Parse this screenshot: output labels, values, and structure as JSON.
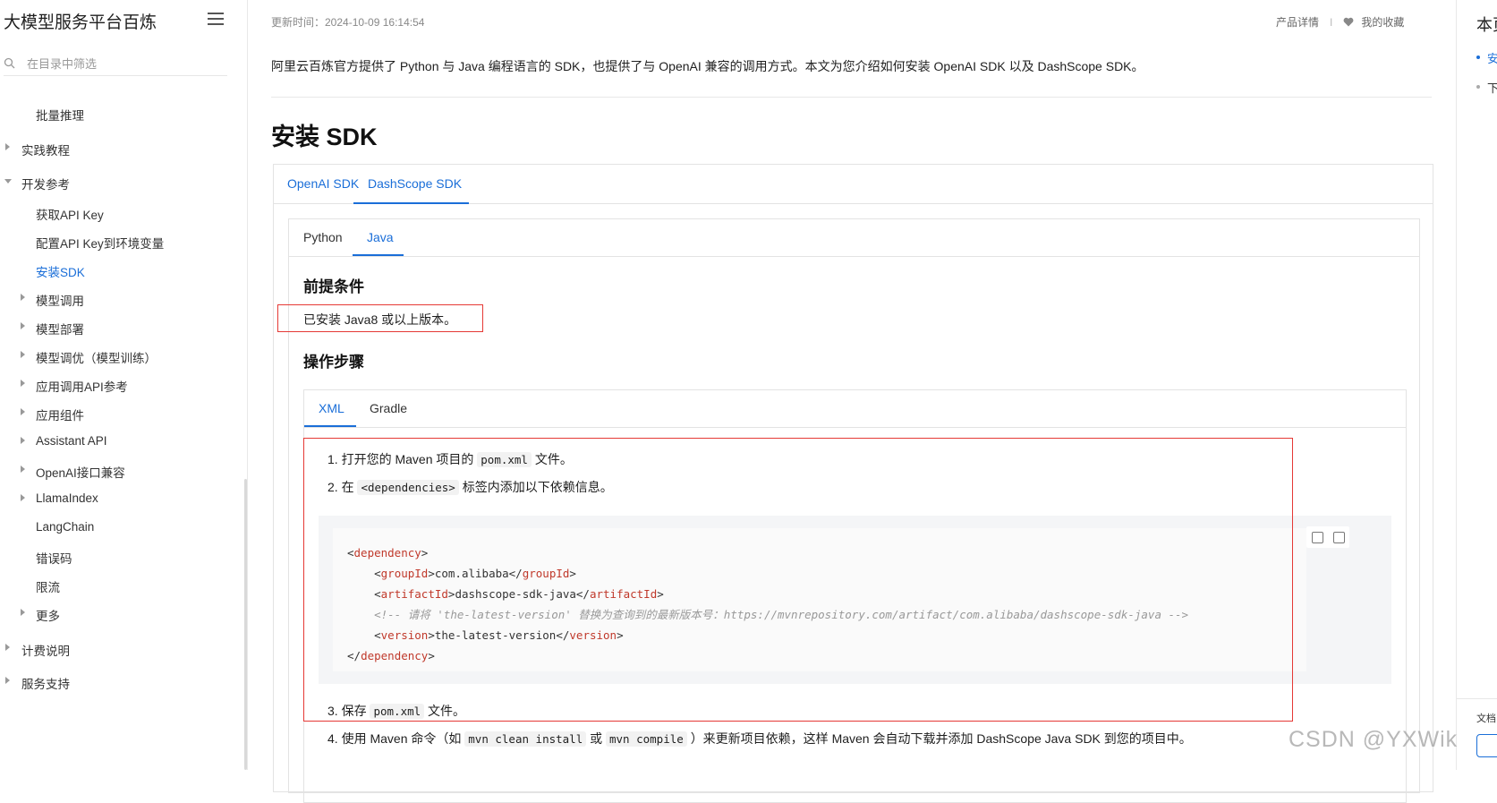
{
  "sidebar": {
    "title": "大模型服务平台百炼",
    "search_placeholder": "在目录中筛选",
    "items": [
      {
        "label": "批量推理"
      },
      {
        "label": "实践教程"
      },
      {
        "label": "开发参考"
      },
      {
        "label": "获取API Key"
      },
      {
        "label": "配置API Key到环境变量"
      },
      {
        "label": "安装SDK"
      },
      {
        "label": "模型调用"
      },
      {
        "label": "模型部署"
      },
      {
        "label": "模型调优（模型训练）"
      },
      {
        "label": "应用调用API参考"
      },
      {
        "label": "应用组件"
      },
      {
        "label": "Assistant API"
      },
      {
        "label": "OpenAI接口兼容"
      },
      {
        "label": "LlamaIndex"
      },
      {
        "label": "LangChain"
      },
      {
        "label": "错误码"
      },
      {
        "label": "限流"
      },
      {
        "label": "更多"
      },
      {
        "label": "计费说明"
      },
      {
        "label": "服务支持"
      }
    ]
  },
  "header": {
    "updated": "更新时间：2024-10-09 16:14:54",
    "product_details": "产品详情",
    "separator": "I",
    "favorites": "我的收藏"
  },
  "main": {
    "intro": "阿里云百炼官方提供了 Python 与 Java 编程语言的 SDK，也提供了与 OpenAI 兼容的调用方式。本文为您介绍如何安装 OpenAI SDK 以及 DashScope SDK。",
    "title": "安装 SDK",
    "sdk_tabs": [
      {
        "label": "OpenAI SDK"
      },
      {
        "label": "DashScope SDK"
      }
    ],
    "lang_tabs": [
      {
        "label": "Python"
      },
      {
        "label": "Java"
      }
    ],
    "prereq_heading": "前提条件",
    "prereq_text": "已安装 Java8 或以上版本。",
    "steps_heading": "操作步骤",
    "build_tabs": [
      {
        "label": "XML"
      },
      {
        "label": "Gradle"
      }
    ],
    "steps": {
      "s1": {
        "num": "1.",
        "pre": "打开您的 Maven 项目的",
        "code": "pom.xml",
        "post": "文件。"
      },
      "s2": {
        "num": "2.",
        "pre": "在",
        "code": "<dependencies>",
        "post": "标签内添加以下依赖信息。"
      },
      "s3": {
        "num": "3.",
        "pre": "保存",
        "code": "pom.xml",
        "post": "文件。"
      },
      "s4": {
        "num": "4.",
        "pre": "使用 Maven 命令（如",
        "code1": "mvn clean install",
        "mid": "或",
        "code2": "mvn compile",
        "post": "）来更新项目依赖，这样 Maven 会自动下载并添加 DashScope Java SDK 到您的项目中。"
      }
    },
    "code": {
      "dependency_tag": "dependency",
      "groupId_tag": "groupId",
      "groupId": "com.alibaba",
      "artifactId_tag": "artifactId",
      "artifactId": "dashscope-sdk-java",
      "comment": "<!-- 请将 'the-latest-version' 替换为查询到的最新版本号：https://mvnrepository.com/artifact/com.alibaba/dashscope-sdk-java -->",
      "version_tag": "version",
      "version": "the-latest-version"
    }
  },
  "right_panel": {
    "title": "本页",
    "items": [
      {
        "label": "安"
      },
      {
        "label": "下"
      }
    ],
    "doc_label": "文档"
  },
  "watermark": "CSDN @YXWik",
  "colors": {
    "accent": "#1a6ed8",
    "annotation_red": "#e53935",
    "xml_tag": "#c0392b"
  }
}
